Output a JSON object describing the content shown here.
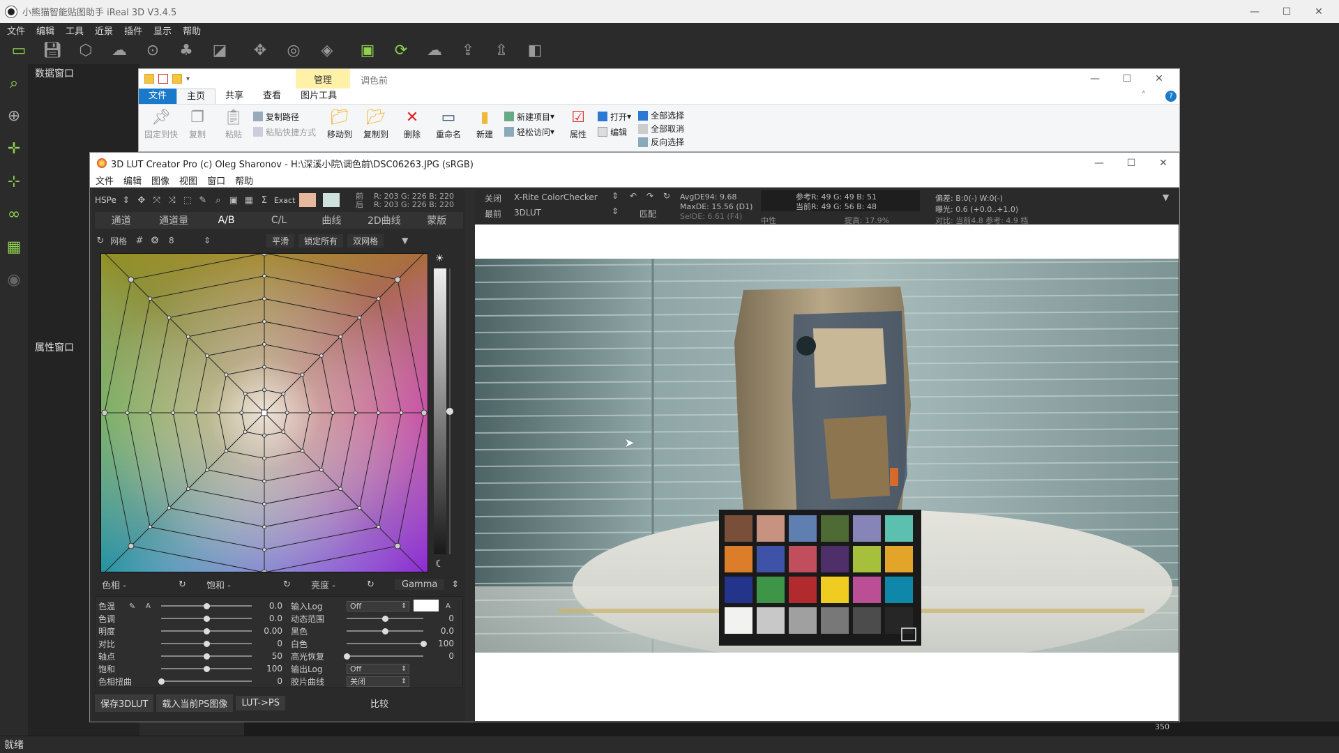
{
  "app": {
    "title": "小熊猫智能贴图助手 iReal 3D V3.4.5",
    "menu": [
      "文件",
      "编辑",
      "工具",
      "近景",
      "插件",
      "显示",
      "帮助"
    ],
    "panels": {
      "data": "数据窗口",
      "props": "属性窗口"
    },
    "status": "就绪",
    "viewport_number": "350"
  },
  "explorer": {
    "context_tab": "管理",
    "window_title": "调色前",
    "tabs": [
      "文件",
      "主页",
      "共享",
      "查看",
      "图片工具"
    ],
    "ribbon": {
      "pin": "固定到快",
      "copy": "复制",
      "paste": "粘贴",
      "copy_path": "复制路径",
      "paste_shortcut": "粘贴快捷方式",
      "move_to": "移动到",
      "copy_to": "复制到",
      "delete": "删除",
      "rename": "重命名",
      "new_folder": "新建",
      "new_item": "新建项目",
      "easy_access": "轻松访问",
      "properties": "属性",
      "open": "打开",
      "edit": "编辑",
      "select_all": "全部选择",
      "select_none": "全部取消",
      "invert": "反向选择"
    }
  },
  "lut": {
    "title": "3D LUT Creator Pro (c) Oleg Sharonov - H:\\深溪小院\\调色前\\DSC06263.JPG (sRGB)",
    "menu": [
      "文件",
      "编辑",
      "图像",
      "视图",
      "窗口",
      "帮助"
    ],
    "color_mode": "HSPe",
    "exact": "Exact",
    "before_label": "前",
    "after_label": "后",
    "readout_before": "R: 203  G: 226  B: 220",
    "readout_after": "R: 203  G: 226  B: 220",
    "swatch_before": "#e8b89c",
    "swatch_after": "#cde2dc",
    "tabs": [
      "通道",
      "通道量",
      "A/B",
      "C/L",
      "曲线",
      "2D曲线",
      "蒙版"
    ],
    "grid_label": "网格",
    "grid_count": "8",
    "buttons_row3": [
      "平滑",
      "锁定所有",
      "双网格"
    ],
    "wheel_footer": {
      "hue": "色相 -",
      "sat": "饱和 -",
      "lum": "亮度 -",
      "gamma": "Gamma"
    },
    "params_left": [
      {
        "label": "色温",
        "value": "0.0",
        "pos": 0.5
      },
      {
        "label": "色调",
        "value": "0.0",
        "pos": 0.5
      },
      {
        "label": "明度",
        "value": "0.00",
        "pos": 0.5
      },
      {
        "label": "对比",
        "value": "0",
        "pos": 0.5
      },
      {
        "label": "轴点",
        "value": "50",
        "pos": 0.5
      },
      {
        "label": "饱和",
        "value": "100",
        "pos": 0.5
      },
      {
        "label": "色相扭曲",
        "value": "0",
        "pos": 0.0
      }
    ],
    "params_right": [
      {
        "label": "输入Log",
        "combo": "Off"
      },
      {
        "label": "动态范围",
        "value": "0",
        "pos": 0.5
      },
      {
        "label": "黑色",
        "value": "0.0",
        "pos": 0.5
      },
      {
        "label": "白色",
        "value": "100",
        "pos": 1.0
      },
      {
        "label": "高光恢复",
        "value": "0",
        "pos": 0.0
      },
      {
        "label": "输出Log",
        "combo": "Off"
      },
      {
        "label": "胶片曲线",
        "combo": "关闭"
      }
    ],
    "footer": [
      "保存3DLUT",
      "载入当前PS图像",
      "LUT->PS"
    ],
    "compare": "比较",
    "header": {
      "close": "关闭",
      "checker": "X-Rite ColorChecker",
      "mode_label": "最前",
      "mode": "3DLUT",
      "match": "匹配",
      "avg_de": "AvgDE94: 9.68",
      "max_de": "MaxDE: 15.56 (D1)",
      "sel_de": "SelDE: 6.61 (F4)",
      "ref": "参考R: 49   G: 49   B: 51",
      "cur": "当前R: 49   G: 56   B: 48",
      "neutral": "中性",
      "improve": "提高: 17.9%",
      "bias": "偏差: B:0(-) W:0(-)",
      "exposure": "曝光: 0.6 (+0.0..+1.0)",
      "contrast": "对比: 当前4.8 参考: 4.9 档"
    }
  }
}
